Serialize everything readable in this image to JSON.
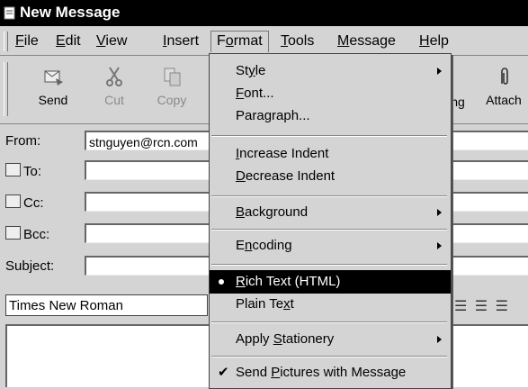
{
  "window": {
    "title": "New Message"
  },
  "menubar": [
    {
      "label": "File",
      "u": "F",
      "rest": "ile"
    },
    {
      "label": "Edit",
      "u": "E",
      "rest": "dit"
    },
    {
      "label": "View",
      "u": "V",
      "rest": "iew"
    },
    {
      "label": "Insert",
      "u": "I",
      "rest": "nsert"
    },
    {
      "label": "Format",
      "pre": "F",
      "u": "o",
      "rest": "rmat"
    },
    {
      "label": "Tools",
      "u": "T",
      "rest": "ools"
    },
    {
      "label": "Message",
      "u": "M",
      "rest": "essage"
    },
    {
      "label": "Help",
      "u": "H",
      "rest": "elp"
    }
  ],
  "toolbar": {
    "send": "Send",
    "cut": "Cut",
    "copy": "Copy",
    "hidden_fragment": "ng",
    "attach": "Attach"
  },
  "headers": {
    "from_label": "From:",
    "from_value": "stnguyen@rcn.com",
    "to_label": "To:",
    "cc_label": "Cc:",
    "bcc_label": "Bcc:",
    "subject_label": "Subject:"
  },
  "format_bar": {
    "font": "Times New Roman"
  },
  "format_menu": {
    "style": {
      "pre": "St",
      "u": "y",
      "post": "le"
    },
    "font": {
      "pre": "",
      "u": "F",
      "post": "ont..."
    },
    "paragraph": {
      "pre": "Para",
      "u": "g",
      "post": "raph..."
    },
    "increase_indent": {
      "pre": "",
      "u": "I",
      "post": "ncrease Indent"
    },
    "decrease_indent": {
      "pre": "",
      "u": "D",
      "post": "ecrease Indent"
    },
    "background": {
      "pre": "",
      "u": "B",
      "post": "ackground"
    },
    "encoding": {
      "pre": "E",
      "u": "n",
      "post": "coding"
    },
    "rich_text": {
      "pre": "",
      "u": "R",
      "post": "ich Text (HTML)"
    },
    "plain_text": {
      "pre": "Plain Te",
      "u": "x",
      "post": "t"
    },
    "apply_stationery": {
      "pre": "Apply ",
      "u": "S",
      "post": "tationery"
    },
    "send_pictures": {
      "pre": "Send ",
      "u": "P",
      "post": "ictures with Message"
    }
  },
  "colors": {
    "titlebar": "#000000",
    "highlight": "#000000",
    "chrome": "#d4d4d4"
  }
}
